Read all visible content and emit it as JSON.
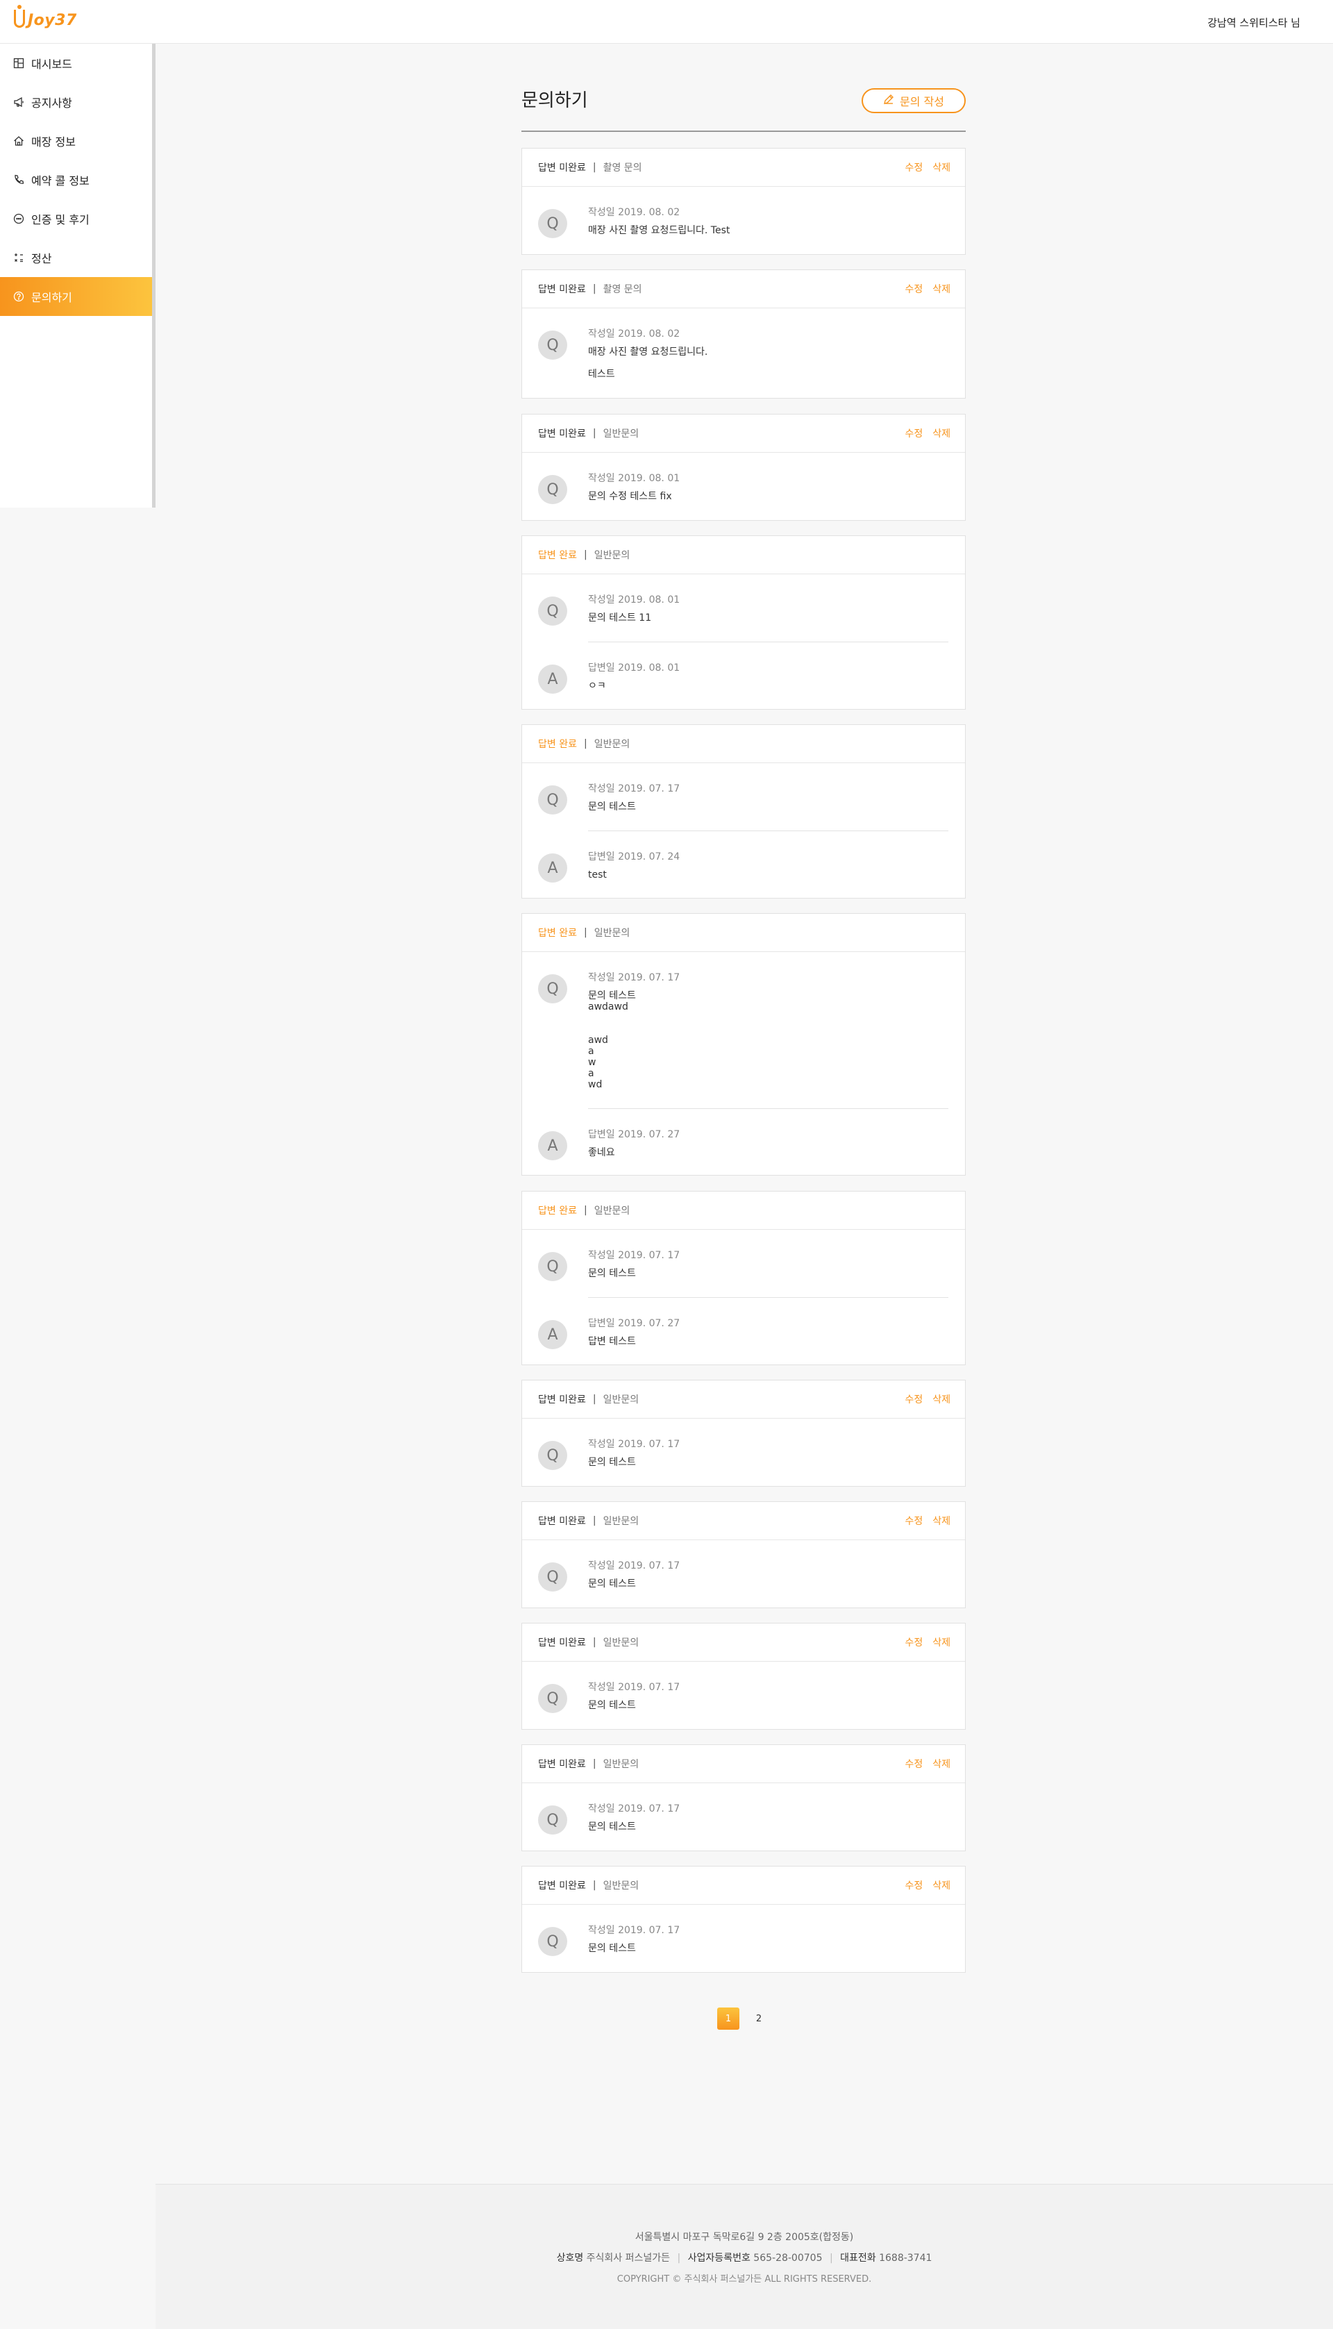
{
  "header": {
    "logo_text": "Joy37",
    "user_name": "강남역 스위티스타 님"
  },
  "sidebar": {
    "items": [
      {
        "label": "대시보드",
        "icon": "dashboard-icon"
      },
      {
        "label": "공지사항",
        "icon": "megaphone-icon"
      },
      {
        "label": "매장 정보",
        "icon": "home-icon"
      },
      {
        "label": "예약 콜 정보",
        "icon": "phone-icon"
      },
      {
        "label": "인증 및 후기",
        "icon": "chat-bubble-icon"
      },
      {
        "label": "정산",
        "icon": "calculator-icon"
      },
      {
        "label": "문의하기",
        "icon": "question-icon",
        "active": true
      }
    ]
  },
  "page": {
    "title": "문의하기",
    "write_button": "문의 작성"
  },
  "labels": {
    "edit": "수정",
    "delete": "삭제",
    "divider": "|",
    "q_badge": "Q",
    "a_badge": "A"
  },
  "inquiries": [
    {
      "status": "답변 미완료",
      "category": "촬영 문의",
      "q_date": "작성일 2019. 08. 02",
      "q_text": "매장 사진 촬영 요청드립니다. Test"
    },
    {
      "status": "답변 미완료",
      "category": "촬영 문의",
      "q_date": "작성일 2019. 08. 02",
      "q_text": "매장 사진 촬영 요청드립니다.\n\n테스트"
    },
    {
      "status": "답변 미완료",
      "category": "일반문의",
      "q_date": "작성일 2019. 08. 01",
      "q_text": "문의 수정 테스트 fix"
    },
    {
      "status": "답변 완료",
      "category": "일반문의",
      "q_date": "작성일 2019. 08. 01",
      "q_text": "문의 테스트 11",
      "a_date": "답변일 2019. 08. 01",
      "a_text": "ㅇㅋ"
    },
    {
      "status": "답변 완료",
      "category": "일반문의",
      "q_date": "작성일 2019. 07. 17",
      "q_text": "문의 테스트",
      "a_date": "답변일 2019. 07. 24",
      "a_text": "test"
    },
    {
      "status": "답변 완료",
      "category": "일반문의",
      "q_date": "작성일 2019. 07. 17",
      "q_text": "문의 테스트\nawdawd\n\n\nawd\na\nw\na\nwd",
      "a_date": "답변일 2019. 07. 27",
      "a_text": "좋네요"
    },
    {
      "status": "답변 완료",
      "category": "일반문의",
      "q_date": "작성일 2019. 07. 17",
      "q_text": "문의 테스트",
      "a_date": "답변일 2019. 07. 27",
      "a_text": "답변 테스트"
    },
    {
      "status": "답변 미완료",
      "category": "일반문의",
      "q_date": "작성일 2019. 07. 17",
      "q_text": "문의 테스트"
    },
    {
      "status": "답변 미완료",
      "category": "일반문의",
      "q_date": "작성일 2019. 07. 17",
      "q_text": "문의 테스트"
    },
    {
      "status": "답변 미완료",
      "category": "일반문의",
      "q_date": "작성일 2019. 07. 17",
      "q_text": "문의 테스트"
    },
    {
      "status": "답변 미완료",
      "category": "일반문의",
      "q_date": "작성일 2019. 07. 17",
      "q_text": "문의 테스트"
    },
    {
      "status": "답변 미완료",
      "category": "일반문의",
      "q_date": "작성일 2019. 07. 17",
      "q_text": "문의 테스트"
    }
  ],
  "pagination": {
    "pages": [
      "1",
      "2"
    ],
    "current": "1"
  },
  "footer": {
    "address": "서울특별시 마포구 독막로6길 9 2층 2005호(합정동)",
    "company_label": "상호명",
    "company_value": "주식회사 퍼스널가든",
    "bizno_label": "사업자등록번호",
    "bizno_value": "565-28-00705",
    "phone_label": "대표전화",
    "phone_value": "1688-3741",
    "copyright": "COPYRIGHT © 주식회사 퍼스널가든 ALL RIGHTS RESERVED."
  },
  "colors": {
    "accent": "#f7941d",
    "accent_light": "#fcc43e"
  }
}
